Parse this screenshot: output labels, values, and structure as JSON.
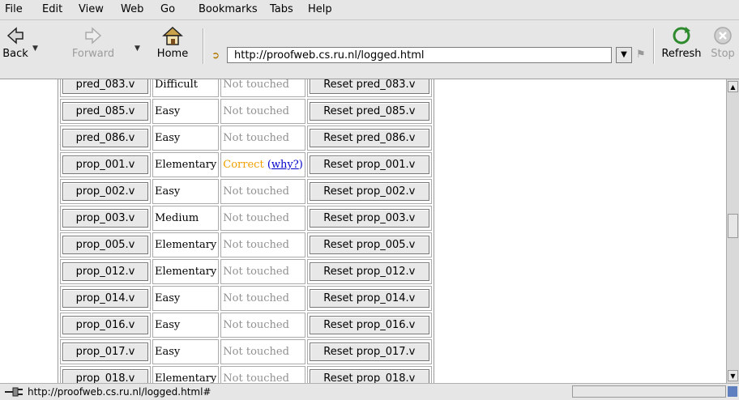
{
  "menubar": {
    "items": [
      "File",
      "Edit",
      "View",
      "Web",
      "Go",
      "Bookmarks",
      "Tabs",
      "Help"
    ]
  },
  "toolbar": {
    "back_label": "Back",
    "forward_label": "Forward",
    "home_label": "Home",
    "refresh_label": "Refresh",
    "stop_label": "Stop"
  },
  "address": {
    "url": "http://proofweb.cs.ru.nl/logged.html"
  },
  "table": {
    "top_row": {
      "name": "pred_083.v",
      "difficulty": "Difficult",
      "status": "Not touched",
      "reset": "Reset pred_083.v"
    },
    "rows": [
      {
        "name": "pred_085.v",
        "difficulty": "Easy",
        "status": "Not touched",
        "reset": "Reset pred_085.v"
      },
      {
        "name": "pred_086.v",
        "difficulty": "Easy",
        "status": "Not touched",
        "reset": "Reset pred_086.v"
      },
      {
        "name": "prop_001.v",
        "difficulty": "Elementary",
        "status": "Correct",
        "why": "why?",
        "reset": "Reset prop_001.v"
      },
      {
        "name": "prop_002.v",
        "difficulty": "Easy",
        "status": "Not touched",
        "reset": "Reset prop_002.v"
      },
      {
        "name": "prop_003.v",
        "difficulty": "Medium",
        "status": "Not touched",
        "reset": "Reset prop_003.v"
      },
      {
        "name": "prop_005.v",
        "difficulty": "Elementary",
        "status": "Not touched",
        "reset": "Reset prop_005.v"
      },
      {
        "name": "prop_012.v",
        "difficulty": "Elementary",
        "status": "Not touched",
        "reset": "Reset prop_012.v"
      },
      {
        "name": "prop_014.v",
        "difficulty": "Easy",
        "status": "Not touched",
        "reset": "Reset prop_014.v"
      },
      {
        "name": "prop_016.v",
        "difficulty": "Easy",
        "status": "Not touched",
        "reset": "Reset prop_016.v"
      },
      {
        "name": "prop_017.v",
        "difficulty": "Easy",
        "status": "Not touched",
        "reset": "Reset prop_017.v"
      },
      {
        "name": "prop_018.v",
        "difficulty": "Elementary",
        "status": "Not touched",
        "reset": "Reset prop_018.v"
      }
    ]
  },
  "statusbar": {
    "text": "http://proofweb.cs.ru.nl/logged.html#"
  },
  "colors": {
    "correct": "#f0a000",
    "link": "#0000cc",
    "not_touched": "#909090"
  }
}
